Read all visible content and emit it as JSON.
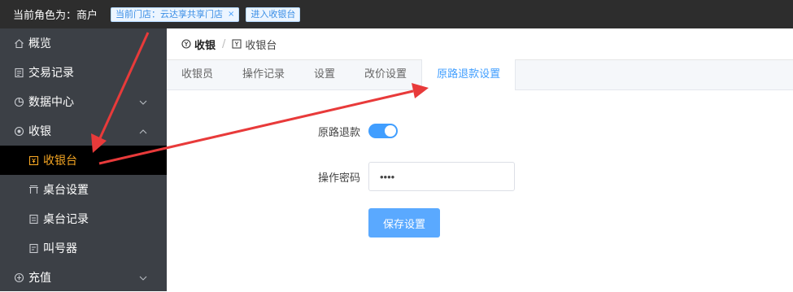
{
  "topbar": {
    "role_label": "当前角色为：商户",
    "store_tag": "当前门店：云达享共享门店",
    "store_tag_close": "×",
    "enter_cashier_tag": "进入收银台"
  },
  "sidebar": {
    "items": [
      {
        "label": "概览",
        "icon": "home-icon"
      },
      {
        "label": "交易记录",
        "icon": "document-icon"
      },
      {
        "label": "数据中心",
        "icon": "pie-chart-icon",
        "chevron": "down"
      },
      {
        "label": "收银",
        "icon": "cashier-icon",
        "chevron": "up",
        "expanded": true
      },
      {
        "label": "收银台",
        "icon": "cash-register-icon",
        "active": true
      },
      {
        "label": "桌台设置",
        "icon": "table-icon"
      },
      {
        "label": "桌台记录",
        "icon": "record-icon"
      },
      {
        "label": "叫号器",
        "icon": "caller-icon"
      },
      {
        "label": "充值",
        "icon": "recharge-icon",
        "chevron": "down"
      }
    ]
  },
  "breadcrumb": {
    "item1": "收银",
    "separator": "/",
    "item2": "收银台"
  },
  "tabs": [
    {
      "label": "收银员"
    },
    {
      "label": "操作记录"
    },
    {
      "label": "设置"
    },
    {
      "label": "改价设置"
    },
    {
      "label": "原路退款设置",
      "active": true
    }
  ],
  "form": {
    "refund_label": "原路退款",
    "refund_enabled": true,
    "password_label": "操作密码",
    "password_value": "••••",
    "save_label": "保存设置"
  },
  "colors": {
    "accent": "#409eff",
    "active_menu_text": "#f5a623",
    "annotation_arrow": "#e83a3a"
  }
}
